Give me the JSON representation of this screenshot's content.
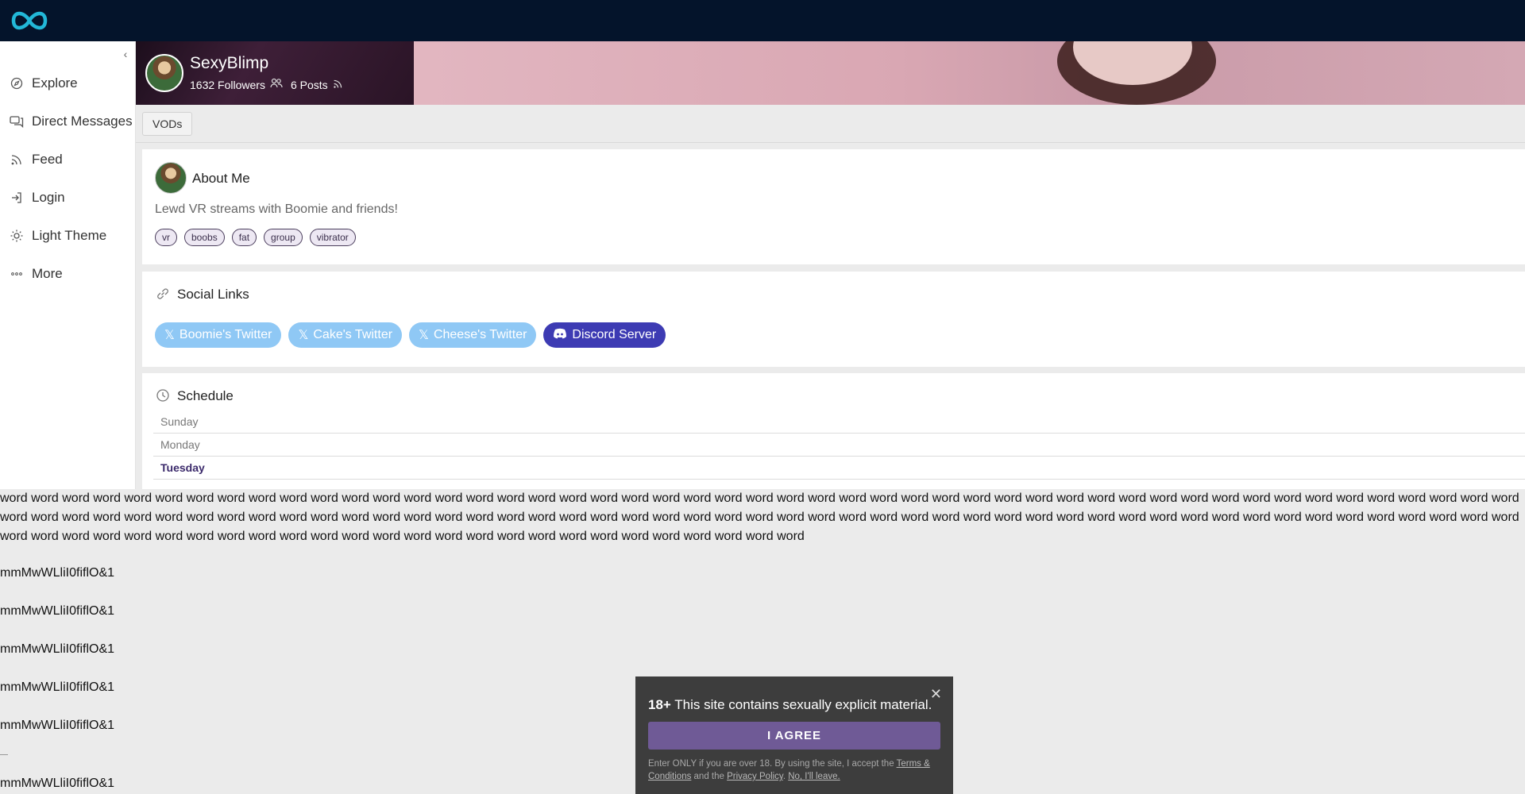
{
  "sidebar": {
    "items": [
      {
        "label": "Explore",
        "icon": "compass-icon"
      },
      {
        "label": "Direct Messages",
        "icon": "chat-icon"
      },
      {
        "label": "Feed",
        "icon": "rss-icon"
      },
      {
        "label": "Login",
        "icon": "login-icon"
      },
      {
        "label": "Light Theme",
        "icon": "sun-icon"
      },
      {
        "label": "More",
        "icon": "dots-icon"
      }
    ]
  },
  "profile": {
    "username": "SexyBlimp",
    "followers": "1632 Followers",
    "posts": "6 Posts"
  },
  "tabs": {
    "vods": "VODs"
  },
  "about": {
    "title": "About Me",
    "text": "Lewd VR streams with Boomie and friends!",
    "tags": [
      "vr",
      "boobs",
      "fat",
      "group",
      "vibrator"
    ]
  },
  "social": {
    "title": "Social Links",
    "links": [
      {
        "label": "Boomie's Twitter",
        "type": "twitter"
      },
      {
        "label": "Cake's Twitter",
        "type": "twitter"
      },
      {
        "label": "Cheese's Twitter",
        "type": "twitter"
      },
      {
        "label": "Discord Server",
        "type": "discord"
      }
    ]
  },
  "schedule": {
    "title": "Schedule",
    "days": [
      "Sunday",
      "Monday",
      "Tuesday"
    ],
    "active_day": "Tuesday"
  },
  "filler": {
    "words": "word word word word word word word word word word word word word word word word word word word word word word word word word word word word word word word word word word word word word word word word word word word word word word word word word word word word word word word word word word word word word word word word word word word word word word word word word word word word word word word word word word word word word word word word word word word word word word word word word word word word word word word word word word word word word word word word word word word word word word word word word word word word",
    "samples": [
      "mmMwWLliI0fiflO&1",
      "mmMwWLliI0fiflO&1",
      "mmMwWLliI0fiflO&1",
      "mmMwWLliI0fiflO&1",
      "mmMwWLliI0fiflO&1",
      "mmMwWLliI0fiflO&1"
    ]
  },
  "age_gate": {
    "badge": "18+",
    "message": "This site contains sexually explicit material.",
    "agree": "I AGREE",
    "fine_prefix": "Enter ONLY if you are over 18. By using the site, I accept the ",
    "terms": "Terms & Conditions",
    "and_text": " and the ",
    "privacy": "Privacy Policy",
    "period": ". ",
    "leave": "No, I'll leave."
  },
  "colors": {
    "topbar": "#04142b",
    "accent": "#6f5a96",
    "discord": "#3d3bb3",
    "twitter": "#8fc8f5"
  }
}
